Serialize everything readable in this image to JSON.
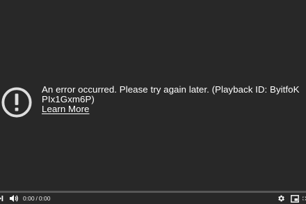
{
  "player": {
    "background": "#282828",
    "error": {
      "icon": "alert-circle-icon",
      "message": "An error occurred. Please try again later. (Playback ID: ByitfoKPIx1Gxm6P)",
      "learn_more": "Learn More"
    },
    "controls": {
      "next_icon": "skip-next-icon",
      "volume_icon": "volume-icon",
      "current_time": "0:00",
      "separator": "/",
      "duration": "0:00",
      "settings_icon": "gear-icon",
      "miniplayer_icon": "miniplayer-icon",
      "fullscreen_icon": "fullscreen-icon"
    }
  }
}
